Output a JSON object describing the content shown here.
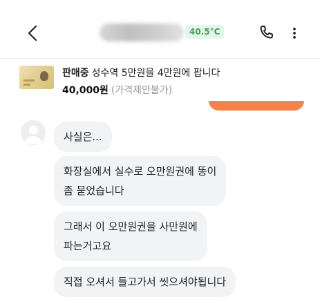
{
  "header": {
    "temperature": "40.5°C",
    "back_icon": "chevron-left-icon",
    "call_icon": "phone-icon",
    "more_icon": "more-vertical-icon"
  },
  "product": {
    "status": "판매중",
    "title": "성수역 5만원을 4만원에 팝니다",
    "price": "40,000원",
    "price_note": "(가격제안불가)"
  },
  "messages": [
    {
      "lines": [
        "사실은..."
      ]
    },
    {
      "lines": [
        "화장실에서 실수로 오만원권에 똥이",
        "좀 묻었습니다"
      ]
    },
    {
      "lines": [
        "그래서 이 오만원권을 사만원에",
        "파는거고요"
      ]
    },
    {
      "lines": [
        "직접 오셔서 들고가서 씻으셔야됩니다"
      ]
    }
  ],
  "colors": {
    "temperature_text": "#45a05a",
    "temperature_bg": "#e6f5e9",
    "accent_orange": "#f4834a",
    "bubble_bg": "#f2f3f5"
  }
}
